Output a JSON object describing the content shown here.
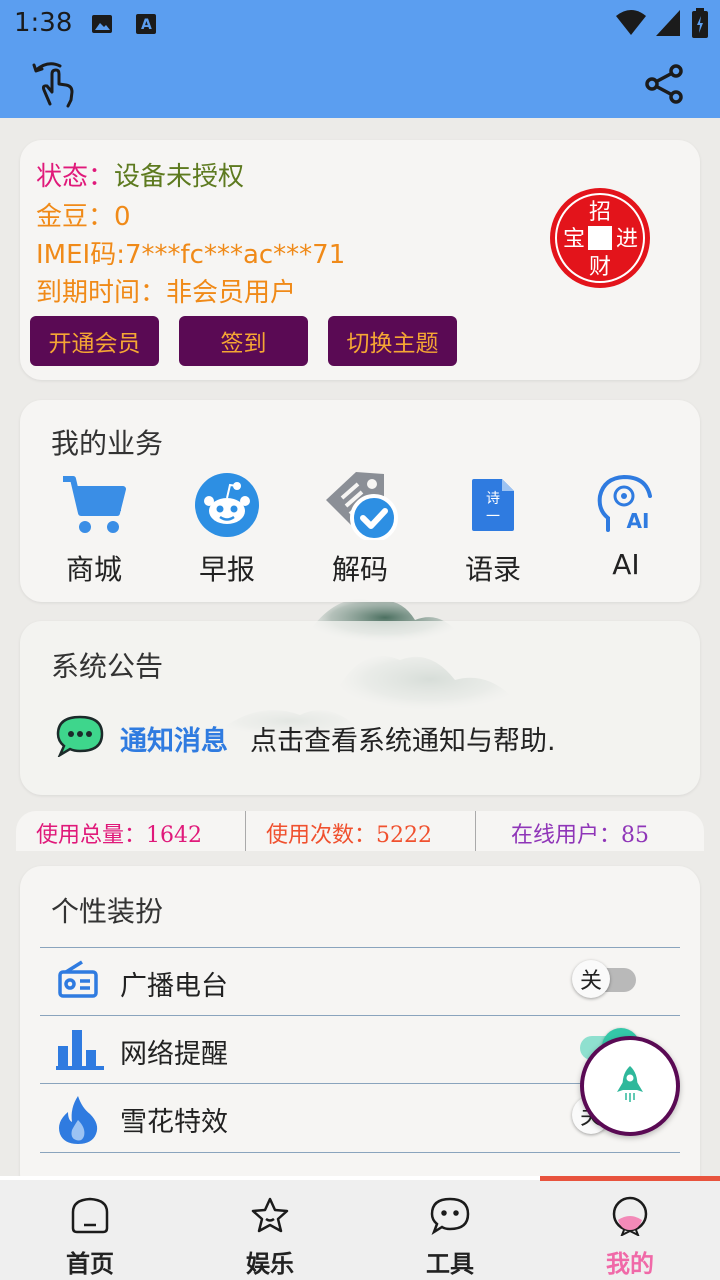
{
  "status_bar": {
    "time": "1:38"
  },
  "account": {
    "status_label": "状态：",
    "status_value": "设备未授权",
    "coins": "金豆：0",
    "imei": "IMEI码:7***fc***ac***71",
    "expire": "到期时间：非会员用户",
    "buttons": [
      "开通会员",
      "签到",
      "切换主题"
    ],
    "seal_chars": [
      "招",
      "宝",
      "进",
      "财"
    ]
  },
  "business": {
    "title": "我的业务",
    "items": [
      {
        "label": "商城",
        "icon": "cart-icon"
      },
      {
        "label": "早报",
        "icon": "reddit-icon"
      },
      {
        "label": "解码",
        "icon": "tag-check-icon"
      },
      {
        "label": "语录",
        "icon": "poem-doc-icon"
      },
      {
        "label": "AI",
        "icon": "ai-head-icon"
      }
    ]
  },
  "notice": {
    "title": "系统公告",
    "tag": "通知消息",
    "text": "点击查看系统通知与帮助."
  },
  "stats": {
    "total": "使用总量：1642",
    "count": "使用次数：5222",
    "online": "在线用户：85"
  },
  "personalization": {
    "title": "个性装扮",
    "rows": [
      {
        "label": "广播电台",
        "icon": "radio-icon",
        "toggle": "关",
        "on": false
      },
      {
        "label": "网络提醒",
        "icon": "bar-chart-icon",
        "toggle": "",
        "on": true
      },
      {
        "label": "雪花特效",
        "icon": "flame-icon",
        "toggle": "关",
        "on": false
      }
    ]
  },
  "nav": {
    "items": [
      {
        "label": "首页",
        "icon": "home-icon"
      },
      {
        "label": "娱乐",
        "icon": "star-icon"
      },
      {
        "label": "工具",
        "icon": "chat-icon"
      },
      {
        "label": "我的",
        "icon": "profile-icon"
      }
    ],
    "active": "我的"
  },
  "colors": {
    "header": "#5b9ef0",
    "button_bg": "#5a0a54",
    "button_text": "#f5a634",
    "active_nav": "#f069a8",
    "indicator": "#e8533d"
  }
}
